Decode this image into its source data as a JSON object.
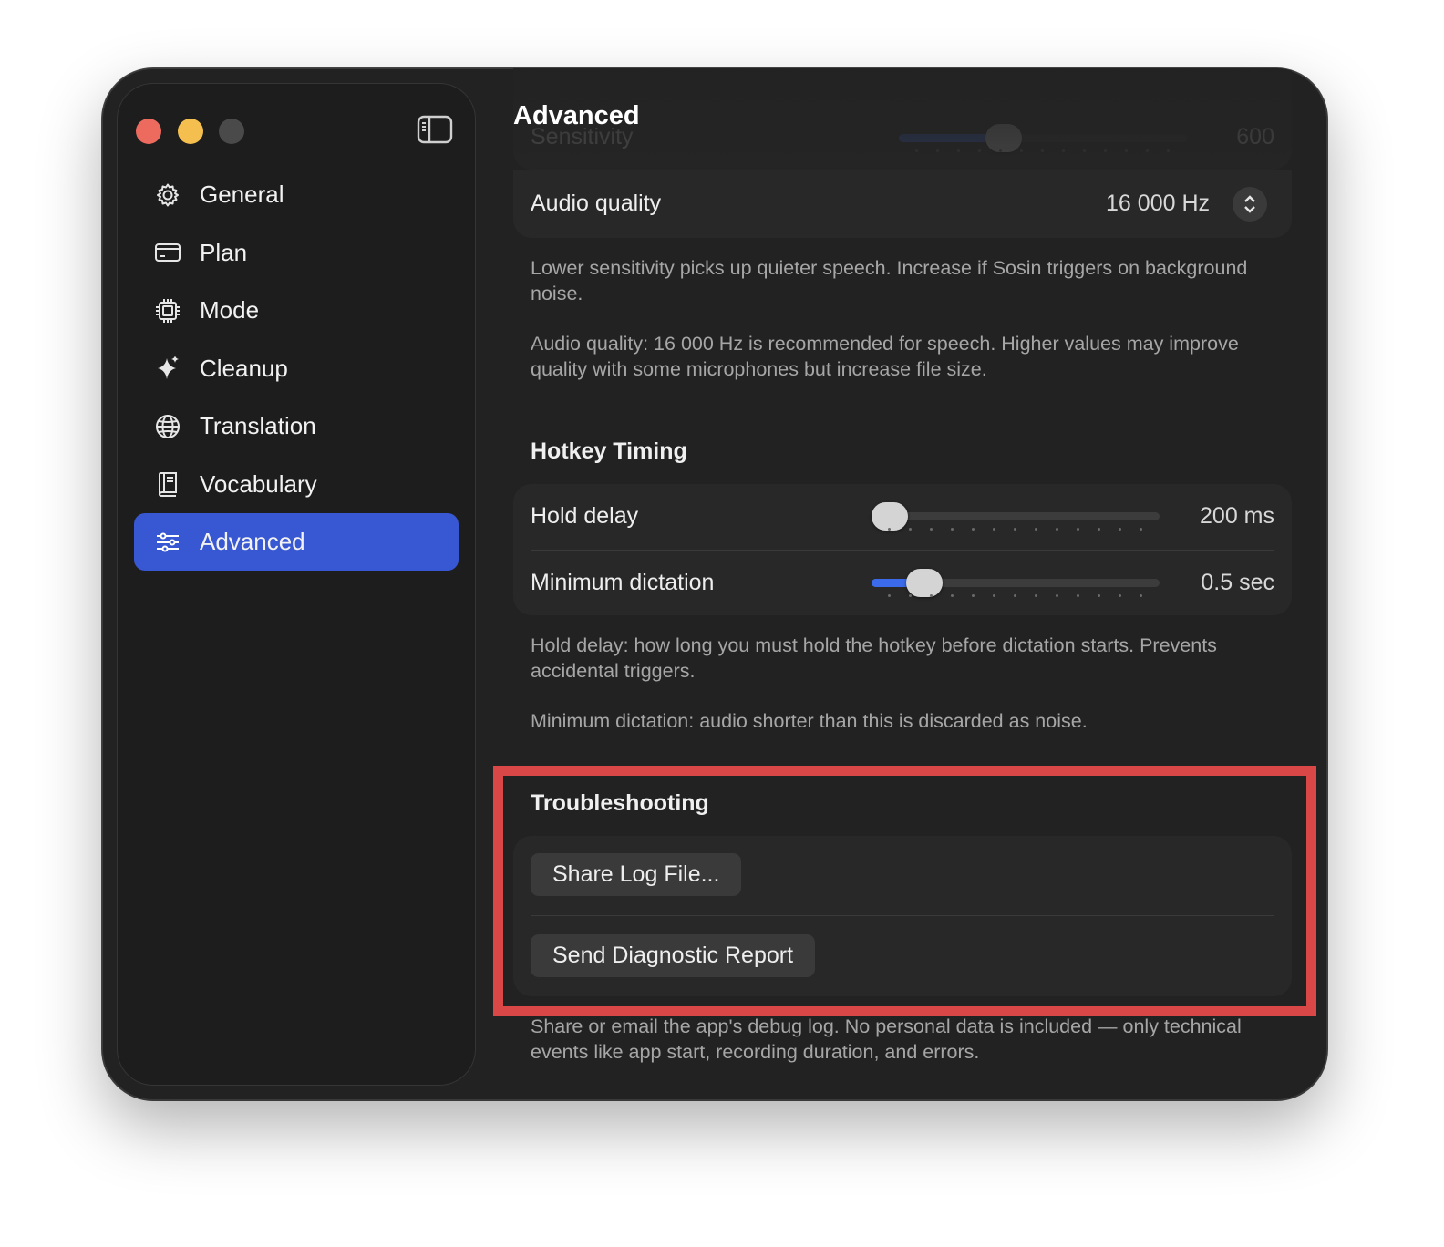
{
  "window": {
    "traffic_lights": [
      "close",
      "minimize",
      "zoom"
    ]
  },
  "sidebar": {
    "items": [
      {
        "label": "General",
        "icon": "gear-icon"
      },
      {
        "label": "Plan",
        "icon": "credit-card-icon"
      },
      {
        "label": "Mode",
        "icon": "cpu-chip-icon"
      },
      {
        "label": "Cleanup",
        "icon": "sparkles-icon"
      },
      {
        "label": "Translation",
        "icon": "globe-icon"
      },
      {
        "label": "Vocabulary",
        "icon": "book-icon"
      },
      {
        "label": "Advanced",
        "icon": "sliders-icon",
        "active": true
      }
    ]
  },
  "main": {
    "title": "Advanced",
    "sensitivity": {
      "label": "Sensitivity",
      "value": "600",
      "level": 0.3
    },
    "audio_quality": {
      "label": "Audio quality",
      "value": "16 000 Hz"
    },
    "audio_desc_1": "Lower sensitivity picks up quieter speech. Increase if Sosin triggers on background noise.",
    "audio_desc_2": "Audio quality: 16 000 Hz is recommended for speech. Higher values may improve quality with some microphones but increase file size.",
    "hotkey_timing": {
      "title": "Hotkey Timing",
      "hold_delay": {
        "label": "Hold delay",
        "value": "200 ms",
        "level": 0.0
      },
      "min_dictation": {
        "label": "Minimum dictation",
        "value": "0.5 sec",
        "level": 0.12
      },
      "desc_1": "Hold delay: how long you must hold the hotkey before dictation starts. Prevents accidental triggers.",
      "desc_2": "Minimum dictation: audio shorter than this is discarded as noise."
    },
    "troubleshooting": {
      "title": "Troubleshooting",
      "share_log": "Share Log File...",
      "send_report": "Send Diagnostic Report",
      "desc": "Share or email the app's debug log. No personal data is included — only technical events like app start, recording duration, and errors."
    }
  },
  "colors": {
    "accent": "#3757d3",
    "slider_fill": "#3b6bea",
    "highlight": "#d94747",
    "close": "#ed6a5e",
    "minimize": "#f4bf4f"
  }
}
